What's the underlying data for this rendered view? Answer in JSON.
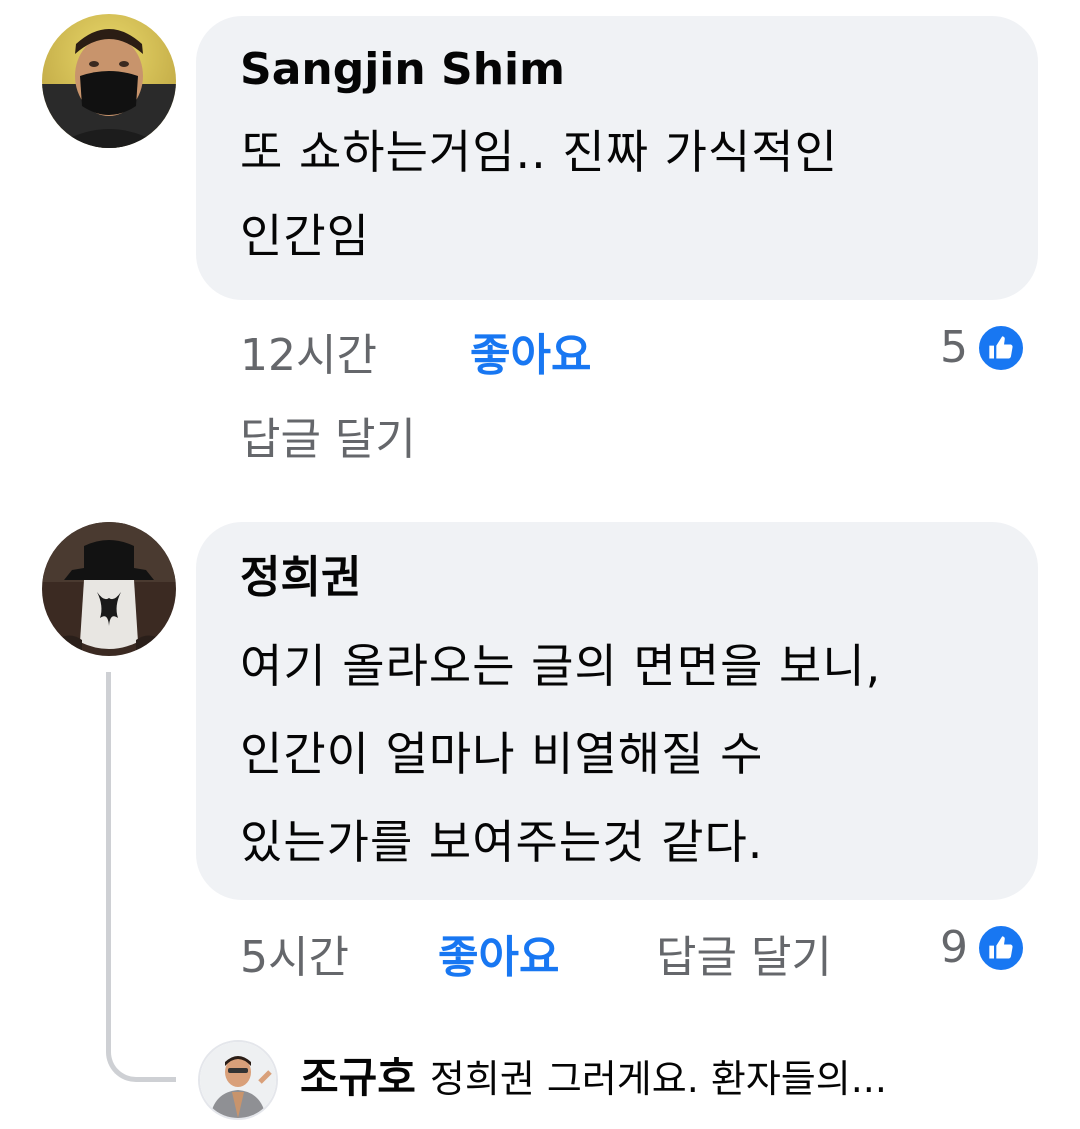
{
  "comments": [
    {
      "author": "Sangjin Shim",
      "lines": [
        "또 쇼하는거임.. 진짜 가식적인",
        "인간임"
      ],
      "time": "12시간",
      "like_label": "좋아요",
      "reply_label": "답글 달기",
      "reaction_count": "5",
      "reaction_icon": "thumbs-up-icon"
    },
    {
      "author": "정희권",
      "lines": [
        "여기 올라오는 글의 면면을 보니,",
        "인간이 얼마나 비열해질 수",
        "있는가를 보여주는것 같다."
      ],
      "time": "5시간",
      "like_label": "좋아요",
      "reply_label": "답글 달기",
      "reaction_count": "9",
      "reaction_icon": "thumbs-up-icon"
    }
  ],
  "reply_preview": {
    "author": "조규호",
    "text": "정희권 그러게요. 환자들의..."
  },
  "colors": {
    "bubble": "#f0f2f5",
    "accent": "#1877f2",
    "secondary_text": "#65676b",
    "thread_line": "#ced0d4"
  }
}
